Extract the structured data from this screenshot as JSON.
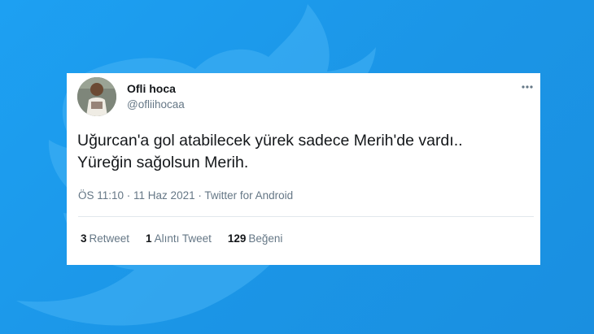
{
  "colors": {
    "background": "#1da1f2",
    "card": "#ffffff",
    "text_primary": "#14171a",
    "text_secondary": "#657786"
  },
  "background_icon": "twitter-bird-icon",
  "tweet": {
    "author": {
      "display_name": "Ofli hoca",
      "handle": "@ofliihocaa",
      "avatar": "avatar-photo"
    },
    "text": "Uğurcan'a gol atabilecek yürek sadece Merih'de vardı..\nYüreğin sağolsun Merih.",
    "meta": "ÖS 11:10 · 11 Haz 2021 · Twitter for Android",
    "more_icon": "more-options-icon",
    "stats": [
      {
        "count": "3",
        "label": "Retweet"
      },
      {
        "count": "1",
        "label": "Alıntı Tweet"
      },
      {
        "count": "129",
        "label": "Beğeni"
      }
    ]
  }
}
